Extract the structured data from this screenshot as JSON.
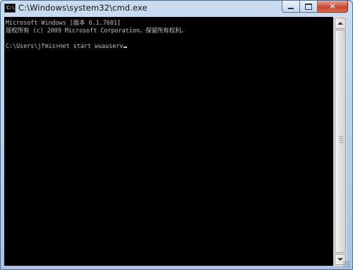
{
  "window": {
    "title": "C:\\Windows\\system32\\cmd.exe",
    "icon_text": "C:\\",
    "buttons": [
      "minimize-icon",
      "maximize-icon",
      "close-icon"
    ]
  },
  "console": {
    "lines": [
      "Microsoft Windows [版本 6.1.7601]",
      "版权所有 (c) 2009 Microsoft Corporation。保留所有权利。",
      "",
      "C:\\Users\\jfmis>net start wuauserv"
    ],
    "text_color": "#c0c0c0",
    "background_color": "#000000"
  }
}
